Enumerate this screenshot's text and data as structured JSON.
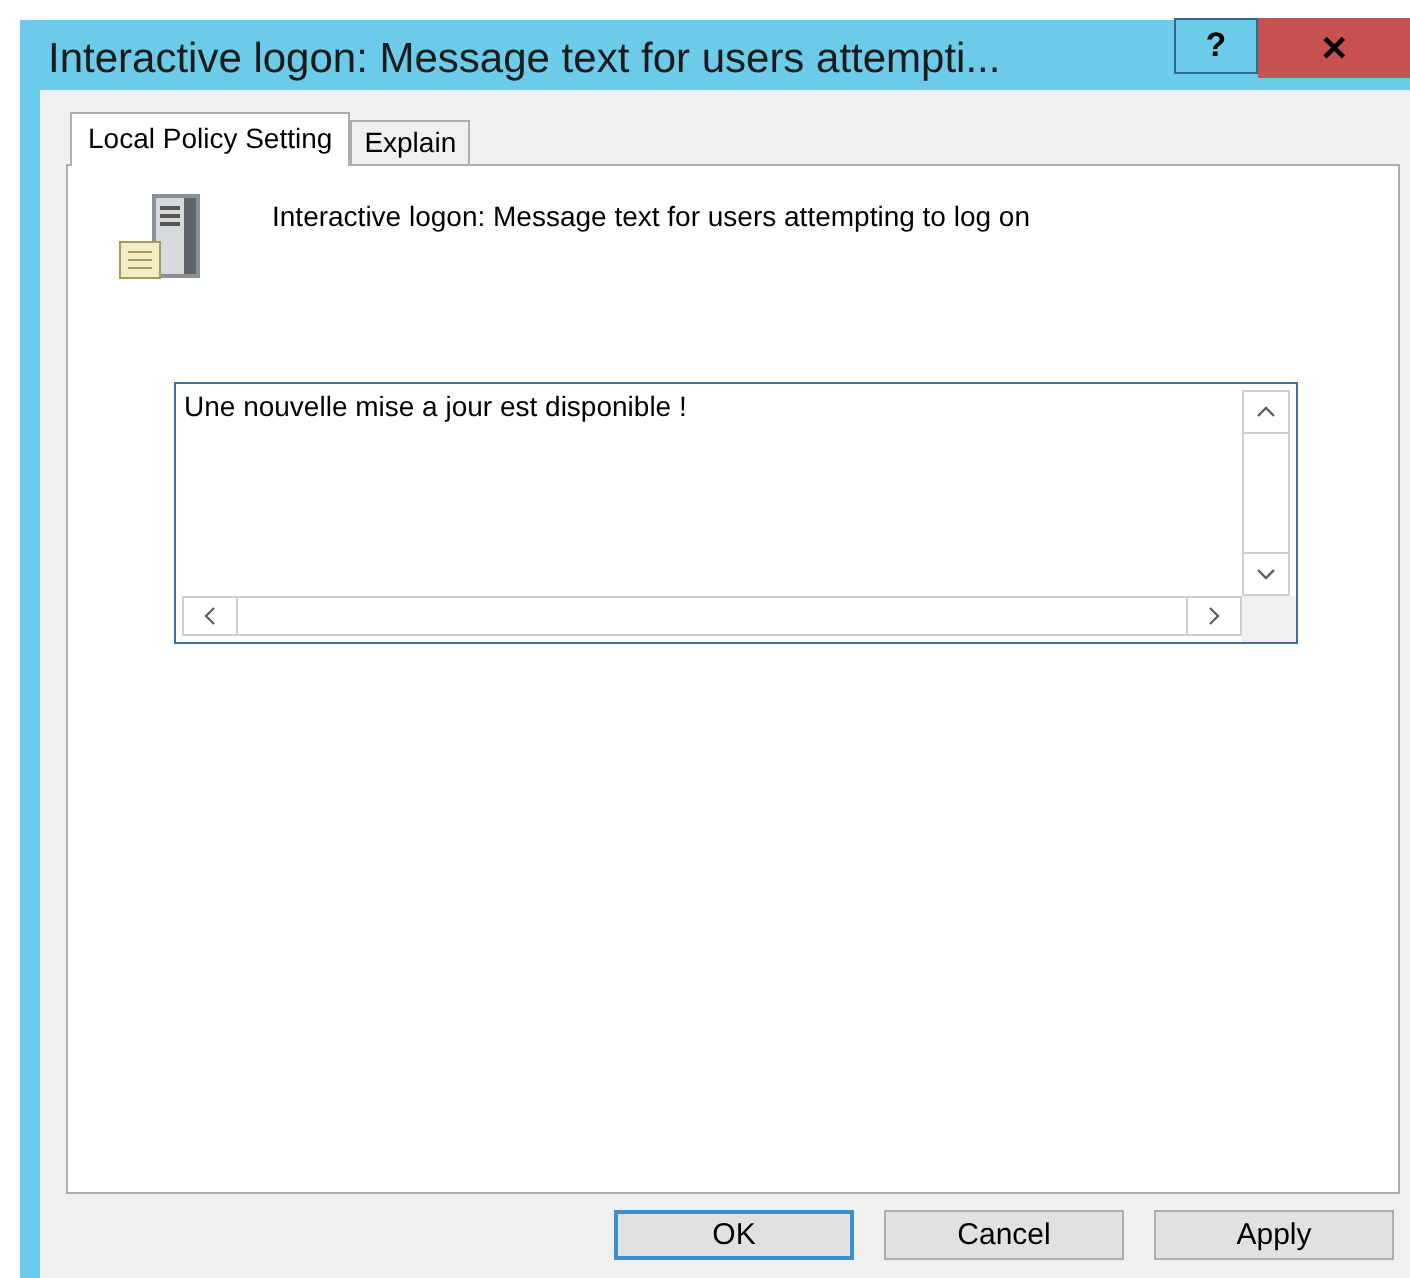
{
  "window": {
    "title": "Interactive logon: Message text for users attempti...",
    "help_button": "?",
    "close_button": "✕"
  },
  "tabs": [
    {
      "label": "Local Policy Setting",
      "selected": true
    },
    {
      "label": "Explain",
      "selected": false
    }
  ],
  "policy": {
    "name": "Interactive logon: Message text for users attempting to log on"
  },
  "message": {
    "value": "Une nouvelle mise a jour est disponible !"
  },
  "buttons": [
    {
      "label": "OK",
      "kind": "default"
    },
    {
      "label": "Cancel",
      "kind": "normal"
    },
    {
      "label": "Apply",
      "kind": "normal"
    }
  ]
}
